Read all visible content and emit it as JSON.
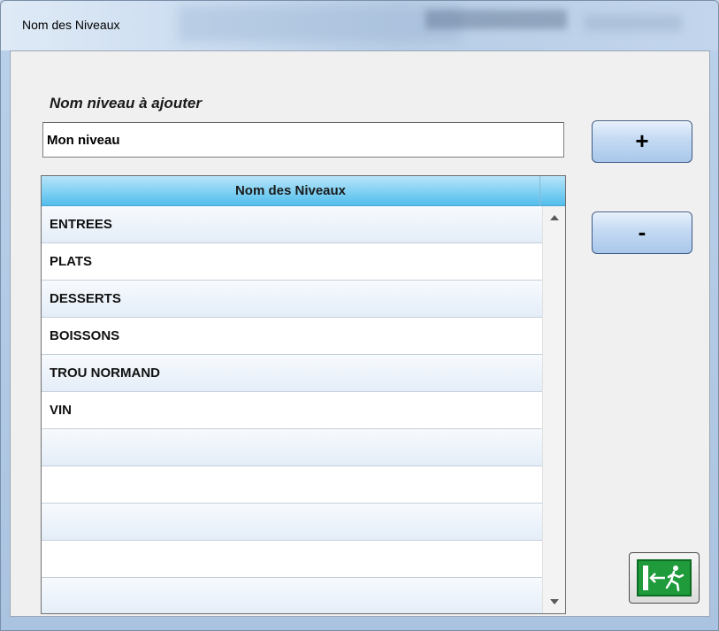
{
  "window": {
    "title": "Nom des Niveaux"
  },
  "form": {
    "add_label": "Nom niveau à ajouter",
    "input_value": "Mon niveau"
  },
  "buttons": {
    "add_label": "+",
    "remove_label": "-",
    "exit_icon": "exit-door-running-man-icon"
  },
  "grid": {
    "header": "Nom des Niveaux",
    "rows": [
      "ENTREES",
      "PLATS",
      "DESSERTS",
      "BOISSONS",
      "TROU NORMAND",
      "VIN",
      "",
      "",
      "",
      "",
      ""
    ]
  },
  "colors": {
    "header_blue": "#7ed0f3",
    "button_blue": "#c4daf3",
    "exit_green": "#1f9b3b"
  }
}
